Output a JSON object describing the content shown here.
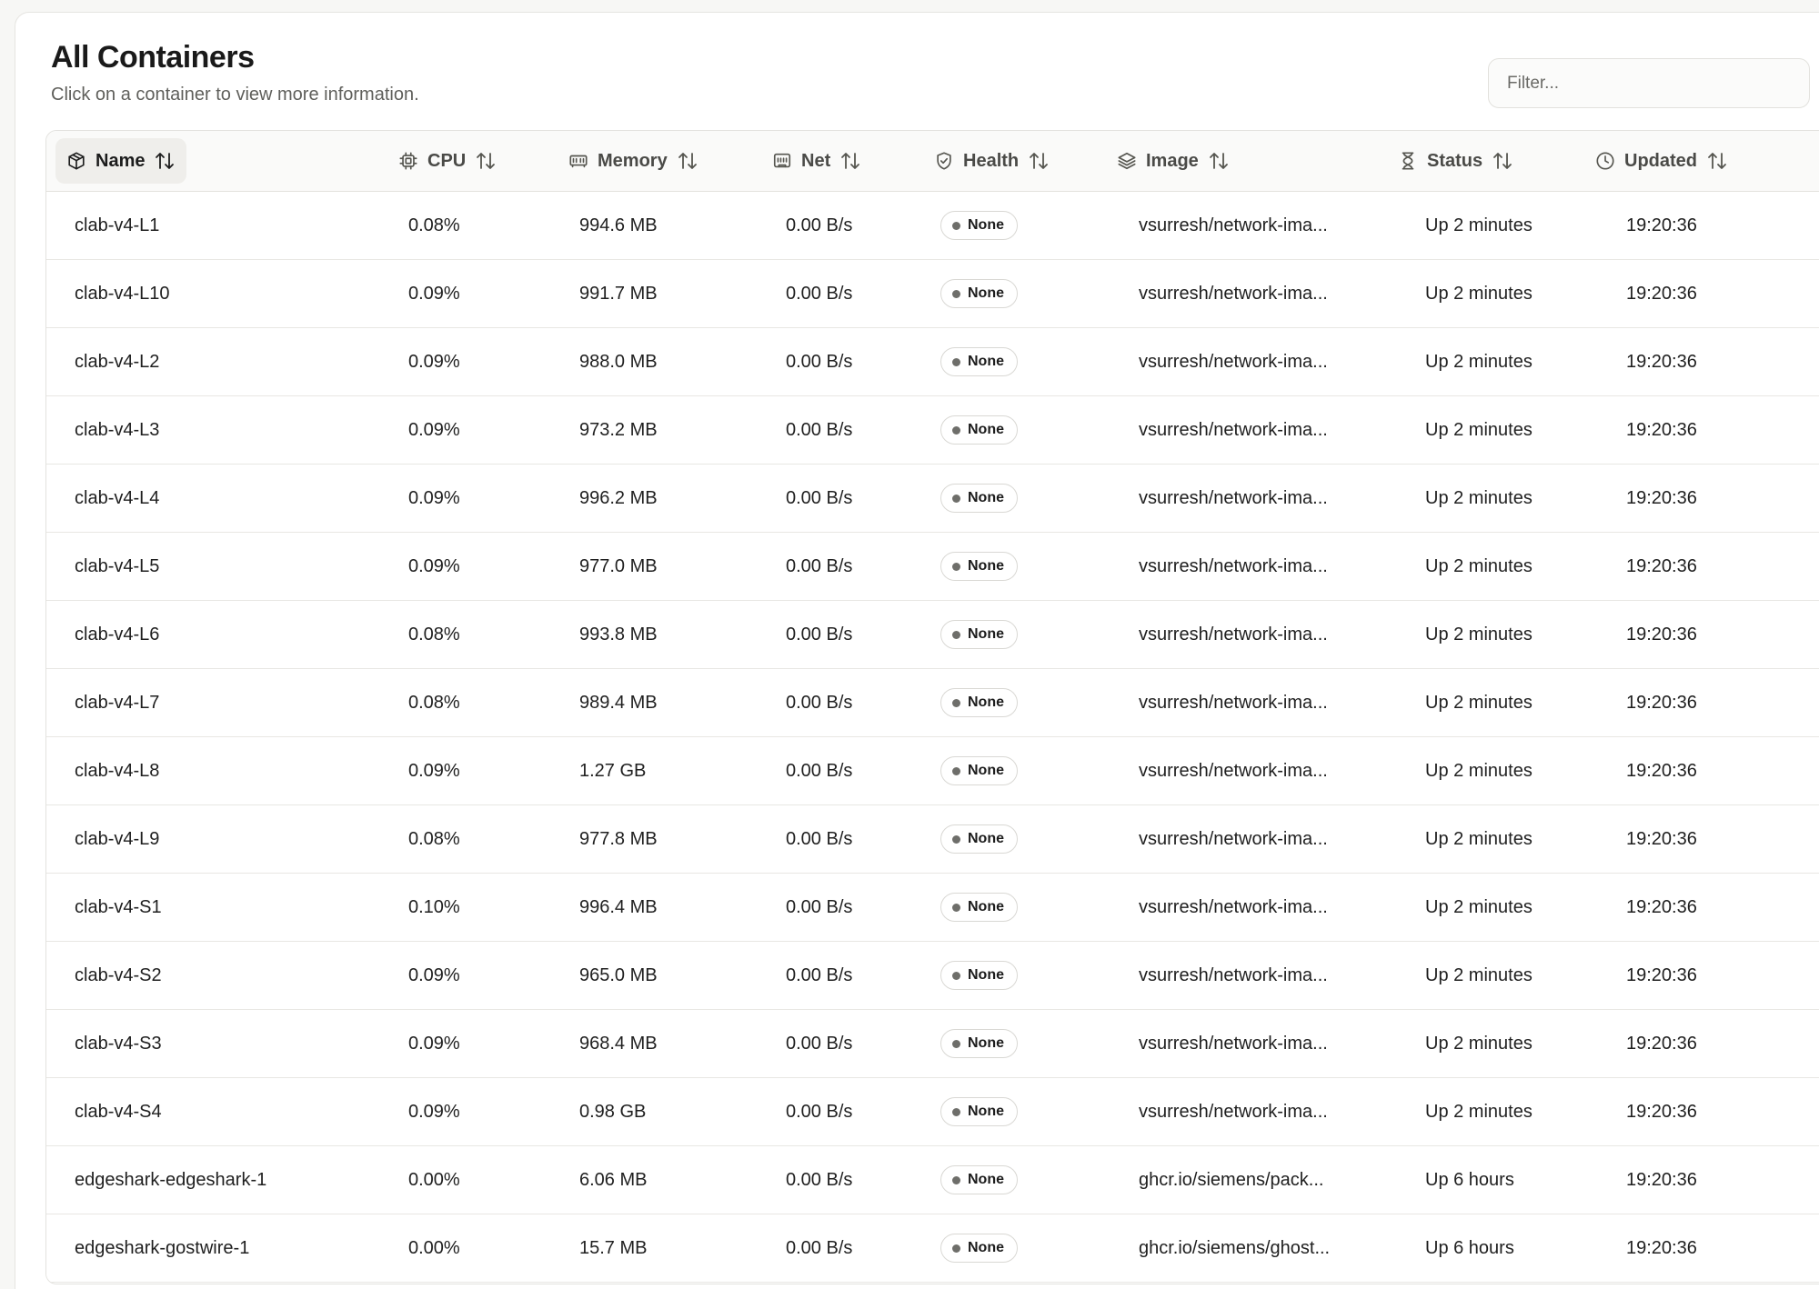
{
  "header": {
    "title": "All Containers",
    "subtitle": "Click on a container to view more information."
  },
  "filter": {
    "placeholder": "Filter...",
    "value": ""
  },
  "columns": [
    {
      "key": "name",
      "label": "Name",
      "icon": "box-icon",
      "sort_icon": "sort-arrows-icon",
      "active": true
    },
    {
      "key": "cpu",
      "label": "CPU",
      "icon": "cpu-icon",
      "sort_icon": "sort-arrows-icon",
      "active": false
    },
    {
      "key": "memory",
      "label": "Memory",
      "icon": "memory-icon",
      "sort_icon": "sort-arrows-icon",
      "active": false
    },
    {
      "key": "net",
      "label": "Net",
      "icon": "ethernet-port-icon",
      "sort_icon": "sort-arrows-icon",
      "active": false
    },
    {
      "key": "health",
      "label": "Health",
      "icon": "shield-icon",
      "sort_icon": "sort-arrows-icon",
      "active": false
    },
    {
      "key": "image",
      "label": "Image",
      "icon": "layers-icon",
      "sort_icon": "sort-arrows-icon",
      "active": false
    },
    {
      "key": "status",
      "label": "Status",
      "icon": "hourglass-icon",
      "sort_icon": "sort-arrows-icon",
      "active": false
    },
    {
      "key": "updated",
      "label": "Updated",
      "icon": "clock-icon",
      "sort_icon": "sort-arrows-icon",
      "active": false
    }
  ],
  "rows": [
    {
      "name": "clab-v4-L1",
      "cpu": "0.08%",
      "memory": "994.6 MB",
      "net": "0.00 B/s",
      "health": "None",
      "image": "vsurresh/network-ima...",
      "status": "Up 2 minutes",
      "updated": "19:20:36"
    },
    {
      "name": "clab-v4-L10",
      "cpu": "0.09%",
      "memory": "991.7 MB",
      "net": "0.00 B/s",
      "health": "None",
      "image": "vsurresh/network-ima...",
      "status": "Up 2 minutes",
      "updated": "19:20:36"
    },
    {
      "name": "clab-v4-L2",
      "cpu": "0.09%",
      "memory": "988.0 MB",
      "net": "0.00 B/s",
      "health": "None",
      "image": "vsurresh/network-ima...",
      "status": "Up 2 minutes",
      "updated": "19:20:36"
    },
    {
      "name": "clab-v4-L3",
      "cpu": "0.09%",
      "memory": "973.2 MB",
      "net": "0.00 B/s",
      "health": "None",
      "image": "vsurresh/network-ima...",
      "status": "Up 2 minutes",
      "updated": "19:20:36"
    },
    {
      "name": "clab-v4-L4",
      "cpu": "0.09%",
      "memory": "996.2 MB",
      "net": "0.00 B/s",
      "health": "None",
      "image": "vsurresh/network-ima...",
      "status": "Up 2 minutes",
      "updated": "19:20:36"
    },
    {
      "name": "clab-v4-L5",
      "cpu": "0.09%",
      "memory": "977.0 MB",
      "net": "0.00 B/s",
      "health": "None",
      "image": "vsurresh/network-ima...",
      "status": "Up 2 minutes",
      "updated": "19:20:36"
    },
    {
      "name": "clab-v4-L6",
      "cpu": "0.08%",
      "memory": "993.8 MB",
      "net": "0.00 B/s",
      "health": "None",
      "image": "vsurresh/network-ima...",
      "status": "Up 2 minutes",
      "updated": "19:20:36"
    },
    {
      "name": "clab-v4-L7",
      "cpu": "0.08%",
      "memory": "989.4 MB",
      "net": "0.00 B/s",
      "health": "None",
      "image": "vsurresh/network-ima...",
      "status": "Up 2 minutes",
      "updated": "19:20:36"
    },
    {
      "name": "clab-v4-L8",
      "cpu": "0.09%",
      "memory": "1.27 GB",
      "net": "0.00 B/s",
      "health": "None",
      "image": "vsurresh/network-ima...",
      "status": "Up 2 minutes",
      "updated": "19:20:36"
    },
    {
      "name": "clab-v4-L9",
      "cpu": "0.08%",
      "memory": "977.8 MB",
      "net": "0.00 B/s",
      "health": "None",
      "image": "vsurresh/network-ima...",
      "status": "Up 2 minutes",
      "updated": "19:20:36"
    },
    {
      "name": "clab-v4-S1",
      "cpu": "0.10%",
      "memory": "996.4 MB",
      "net": "0.00 B/s",
      "health": "None",
      "image": "vsurresh/network-ima...",
      "status": "Up 2 minutes",
      "updated": "19:20:36"
    },
    {
      "name": "clab-v4-S2",
      "cpu": "0.09%",
      "memory": "965.0 MB",
      "net": "0.00 B/s",
      "health": "None",
      "image": "vsurresh/network-ima...",
      "status": "Up 2 minutes",
      "updated": "19:20:36"
    },
    {
      "name": "clab-v4-S3",
      "cpu": "0.09%",
      "memory": "968.4 MB",
      "net": "0.00 B/s",
      "health": "None",
      "image": "vsurresh/network-ima...",
      "status": "Up 2 minutes",
      "updated": "19:20:36"
    },
    {
      "name": "clab-v4-S4",
      "cpu": "0.09%",
      "memory": "0.98 GB",
      "net": "0.00 B/s",
      "health": "None",
      "image": "vsurresh/network-ima...",
      "status": "Up 2 minutes",
      "updated": "19:20:36"
    },
    {
      "name": "edgeshark-edgeshark-1",
      "cpu": "0.00%",
      "memory": "6.06 MB",
      "net": "0.00 B/s",
      "health": "None",
      "image": "ghcr.io/siemens/pack...",
      "status": "Up 6 hours",
      "updated": "19:20:36"
    },
    {
      "name": "edgeshark-gostwire-1",
      "cpu": "0.00%",
      "memory": "15.7 MB",
      "net": "0.00 B/s",
      "health": "None",
      "image": "ghcr.io/siemens/ghost...",
      "status": "Up 6 hours",
      "updated": "19:20:36"
    }
  ],
  "colors": {
    "background": "#f7f7f5",
    "card": "#ffffff",
    "border": "#e3e2de",
    "header_bg": "#fafaf9",
    "active_header_bg": "#efeeeb",
    "text": "#1f1f1f",
    "muted_text": "#5f5f5b",
    "badge_dot": "#6e6e6a"
  }
}
